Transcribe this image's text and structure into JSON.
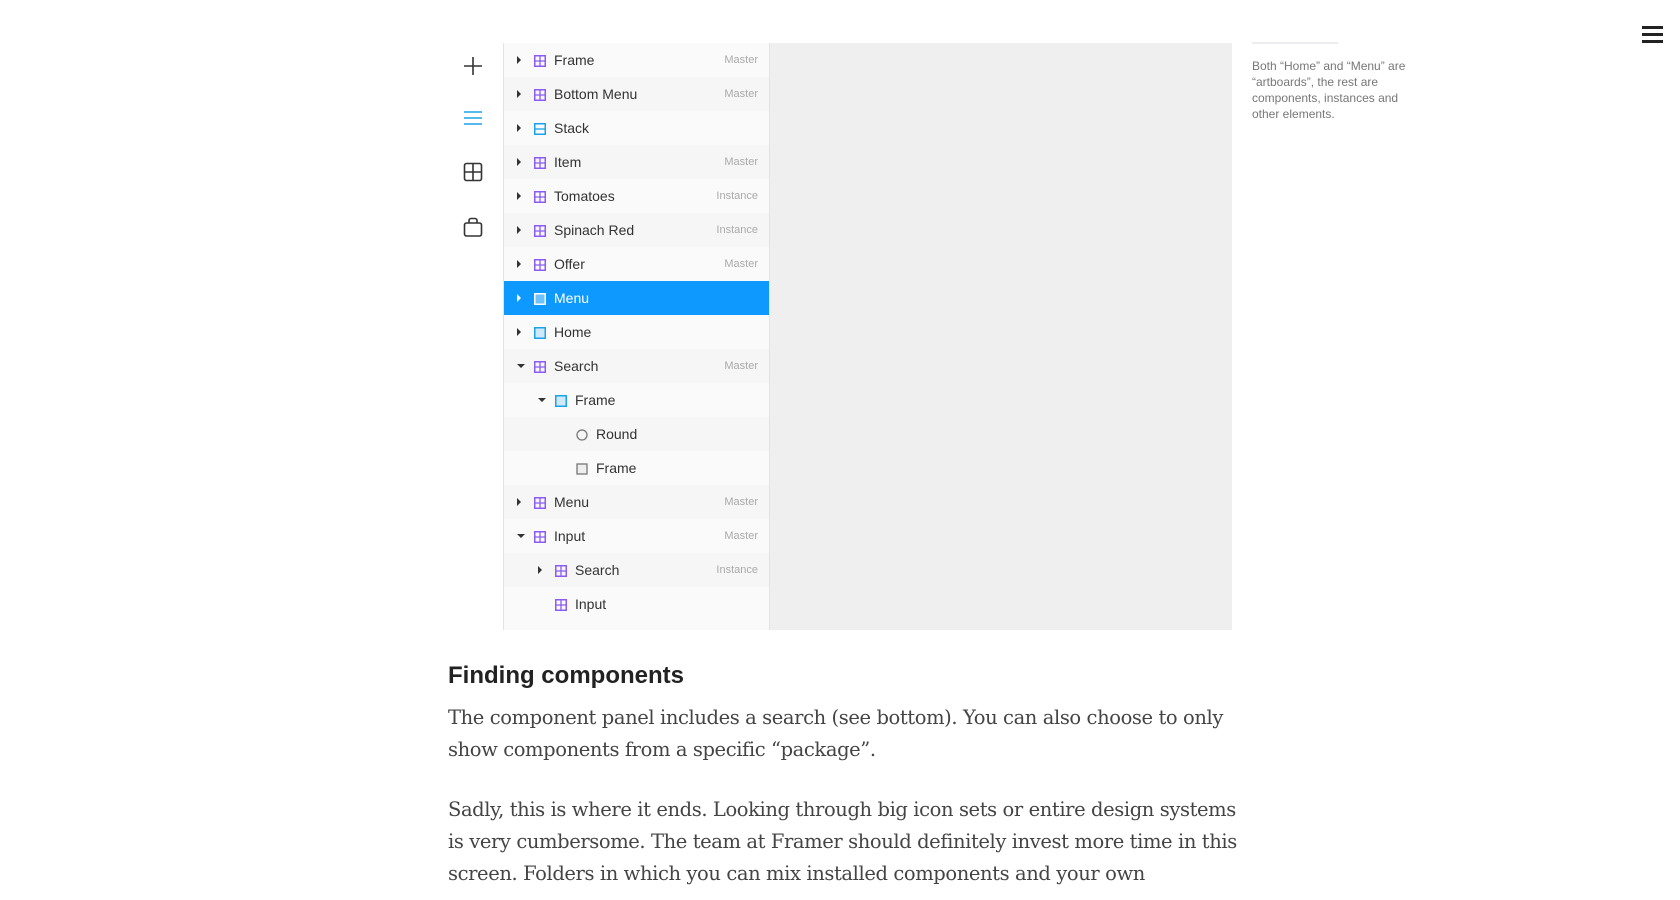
{
  "sidebar_icons": [
    "plus-icon",
    "layers-icon",
    "components-icon",
    "store-icon"
  ],
  "layers": [
    {
      "label": "Frame",
      "tag": "Master",
      "icon": "component",
      "level": 0,
      "arrow": "right"
    },
    {
      "label": "Bottom Menu",
      "tag": "Master",
      "icon": "component",
      "level": 0,
      "arrow": "right"
    },
    {
      "label": "Stack",
      "tag": "",
      "icon": "stack",
      "level": 0,
      "arrow": "right"
    },
    {
      "label": "Item",
      "tag": "Master",
      "icon": "component",
      "level": 0,
      "arrow": "right"
    },
    {
      "label": "Tomatoes",
      "tag": "Instance",
      "icon": "component",
      "level": 0,
      "arrow": "right"
    },
    {
      "label": "Spinach Red",
      "tag": "Instance",
      "icon": "component",
      "level": 0,
      "arrow": "right"
    },
    {
      "label": "Offer",
      "tag": "Master",
      "icon": "component",
      "level": 0,
      "arrow": "right"
    },
    {
      "label": "Menu",
      "tag": "",
      "icon": "frame",
      "level": 0,
      "arrow": "right",
      "selected": true
    },
    {
      "label": "Home",
      "tag": "",
      "icon": "frame",
      "level": 0,
      "arrow": "right"
    },
    {
      "label": "Search",
      "tag": "Master",
      "icon": "component",
      "level": 0,
      "arrow": "down"
    },
    {
      "label": "Frame",
      "tag": "",
      "icon": "frame",
      "level": 1,
      "arrow": "down"
    },
    {
      "label": "Round",
      "tag": "",
      "icon": "oval",
      "level": 2,
      "arrow": ""
    },
    {
      "label": "Frame",
      "tag": "",
      "icon": "rect",
      "level": 2,
      "arrow": ""
    },
    {
      "label": "Menu",
      "tag": "Master",
      "icon": "component",
      "level": 0,
      "arrow": "right"
    },
    {
      "label": "Input",
      "tag": "Master",
      "icon": "component",
      "level": 0,
      "arrow": "down"
    },
    {
      "label": "Search",
      "tag": "Instance",
      "icon": "component",
      "level": 1,
      "arrow": "right"
    },
    {
      "label": "Input",
      "tag": "",
      "icon": "component",
      "level": 1,
      "arrow": ""
    }
  ],
  "caption": "Both “Home” and “Menu” are “artboards”, the rest are components, instances and other elements.",
  "article": {
    "heading": "Finding components",
    "p1": "The component panel includes a search (see bottom). You can also choose to only show components from a specific “package”.",
    "p2": "Sadly, this is where it ends. Looking through big icon sets or entire design systems is very cumbersome. The team at Framer should definitely invest more time in this screen. Folders in which you can mix installed components and your own"
  },
  "colors": {
    "accent": "#0d99ff",
    "component": "#8a5cf5",
    "frame": "#1aa3e8"
  }
}
